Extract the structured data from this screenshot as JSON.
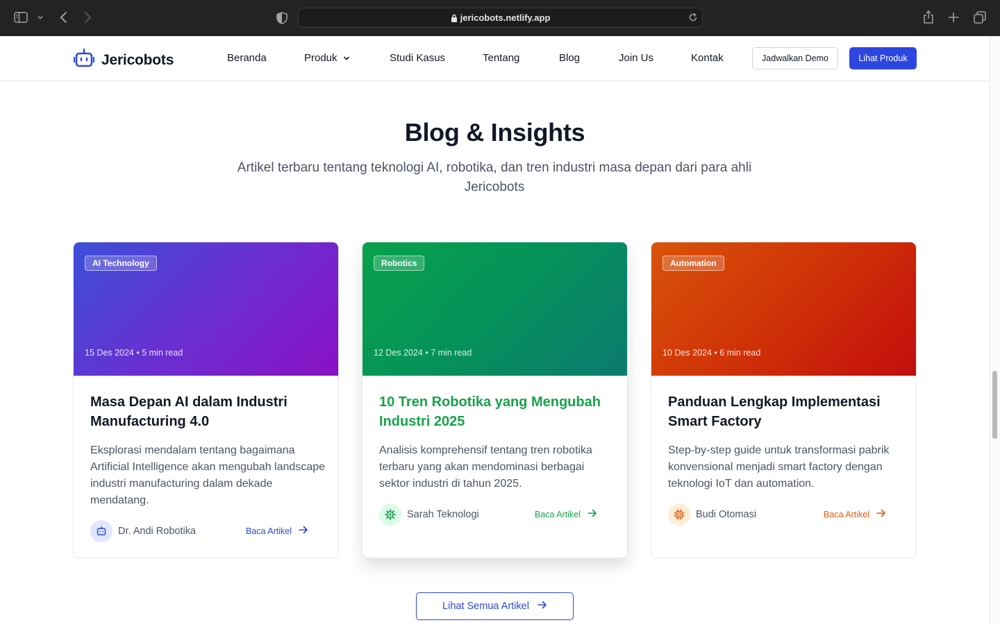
{
  "browser": {
    "url": "jericobots.netlify.app"
  },
  "nav": {
    "logo_text": "Jericobots",
    "links": [
      "Beranda",
      "Produk",
      "Studi Kasus",
      "Tentang",
      "Blog",
      "Join Us",
      "Kontak"
    ],
    "demo_button": "Jadwalkan Demo",
    "product_button": "Lihat Produk"
  },
  "section": {
    "title": "Blog & Insights",
    "subtitle": "Artikel terbaru tentang teknologi AI, robotika, dan tren industri masa depan dari para ahli Jericobots"
  },
  "cards": [
    {
      "category": "AI Technology",
      "meta": "15 Des 2024 • 5 min read",
      "title": "Masa Depan AI dalam Industri Manufacturing 4.0",
      "description": "Eksplorasi mendalam tentang bagaimana Artificial Intelligence akan mengubah landscape industri manufacturing dalam dekade mendatang.",
      "author": "Dr. Andi Robotika",
      "read_label": "Baca Artikel",
      "accent": "#2d46e0",
      "avatar_icon": "robot-icon"
    },
    {
      "category": "Robotics",
      "meta": "12 Des 2024 • 7 min read",
      "title": "10 Tren Robotika yang Mengubah Industri 2025",
      "description": "Analisis komprehensif tentang tren robotika terbaru yang akan mendominasi berbagai sektor industri di tahun 2025.",
      "author": "Sarah Teknologi",
      "read_label": "Baca Artikel",
      "accent": "#16a34a",
      "avatar_icon": "gear-icon"
    },
    {
      "category": "Automation",
      "meta": "10 Des 2024 • 6 min read",
      "title": "Panduan Lengkap Implementasi Smart Factory",
      "description": "Step-by-step guide untuk transformasi pabrik konvensional menjadi smart factory dengan teknologi IoT dan automation.",
      "author": "Budi Otomasi",
      "read_label": "Baca Artikel",
      "accent": "#ea580c",
      "avatar_icon": "chip-icon"
    }
  ],
  "cta": {
    "label": "Lihat Semua Artikel"
  }
}
